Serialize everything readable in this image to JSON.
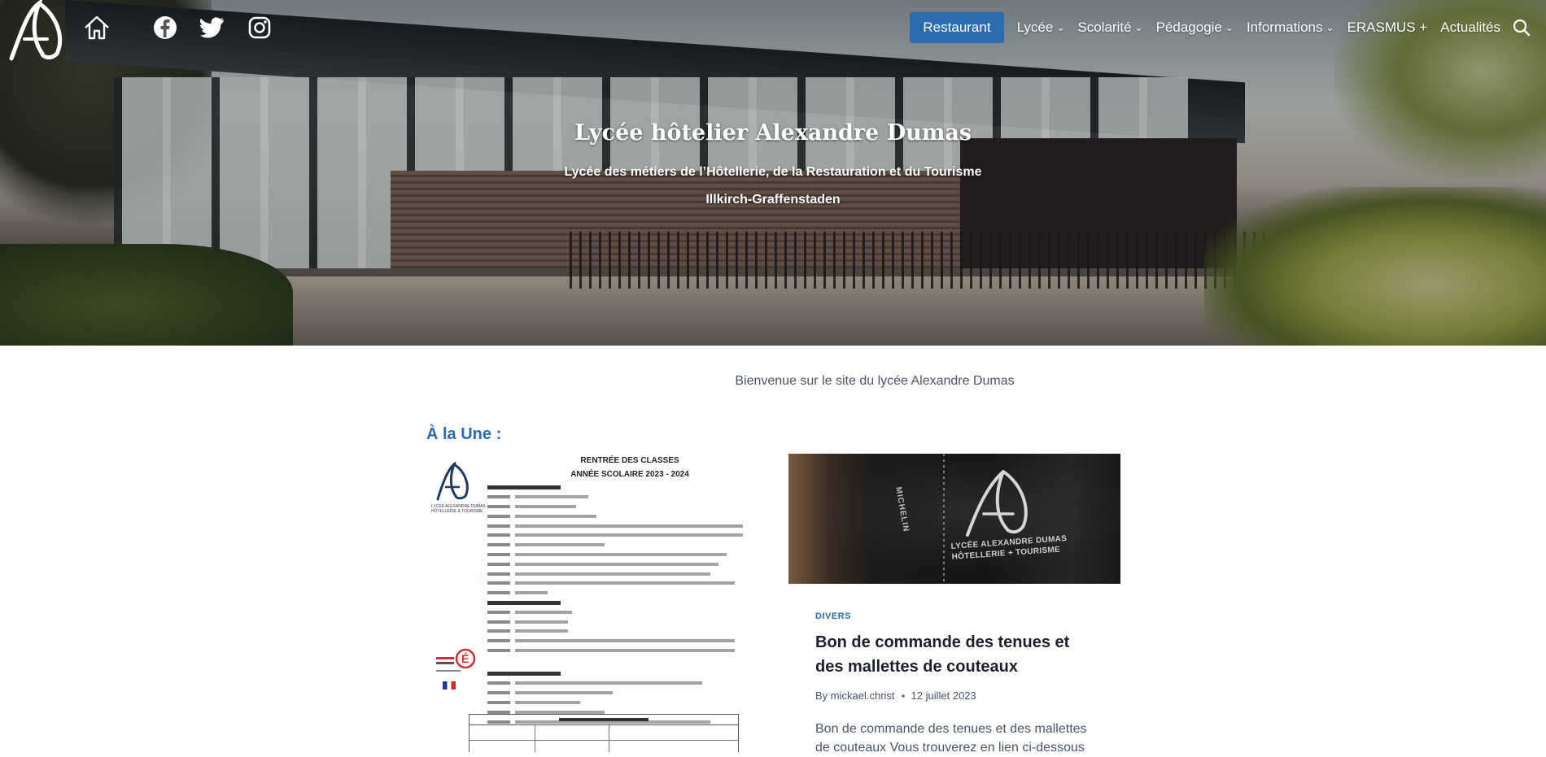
{
  "hero": {
    "title": "Lycée hôtelier Alexandre Dumas",
    "subtitle": "Lycée des métiers de l’Hôtellerie, de la Restauration et du Tourisme",
    "location": "Illkirch-Graffenstaden"
  },
  "header": {
    "icons": [
      "home-icon",
      "facebook-icon",
      "twitter-icon",
      "instagram-icon",
      "search-icon"
    ],
    "nav": [
      {
        "label": "Restaurant",
        "active": true,
        "dropdown": false
      },
      {
        "label": "Lycée",
        "dropdown": true
      },
      {
        "label": "Scolarité",
        "dropdown": true
      },
      {
        "label": "Pédagogie",
        "dropdown": true
      },
      {
        "label": "Informations",
        "dropdown": true
      },
      {
        "label": "ERASMUS +",
        "dropdown": true
      },
      {
        "label": "Actualités",
        "dropdown": false
      }
    ],
    "accent": "#2b6cb0"
  },
  "main": {
    "welcome": "Bienvenue sur le site du lycée Alexandre Dumas",
    "une_heading": "À la Une :",
    "poster": {
      "title_line1": "RENTRÉE DES CLASSES",
      "title_line2": "ANNÉE SCOLAIRE 2023 - 2024"
    },
    "post": {
      "category": "DIVERS",
      "title": "Bon de commande des tenues et des mallettes de couteaux",
      "author": "By mickael.christ",
      "date": "12 juillet 2023",
      "excerpt": "Bon de commande des tenues et des mallettes de couteaux Vous trouverez en lien ci-dessous",
      "image_text": "LYCÉE ALEXANDRE DUMAS HÔTELLERIE + TOURISME",
      "image_brand": "MICHELIN"
    }
  }
}
